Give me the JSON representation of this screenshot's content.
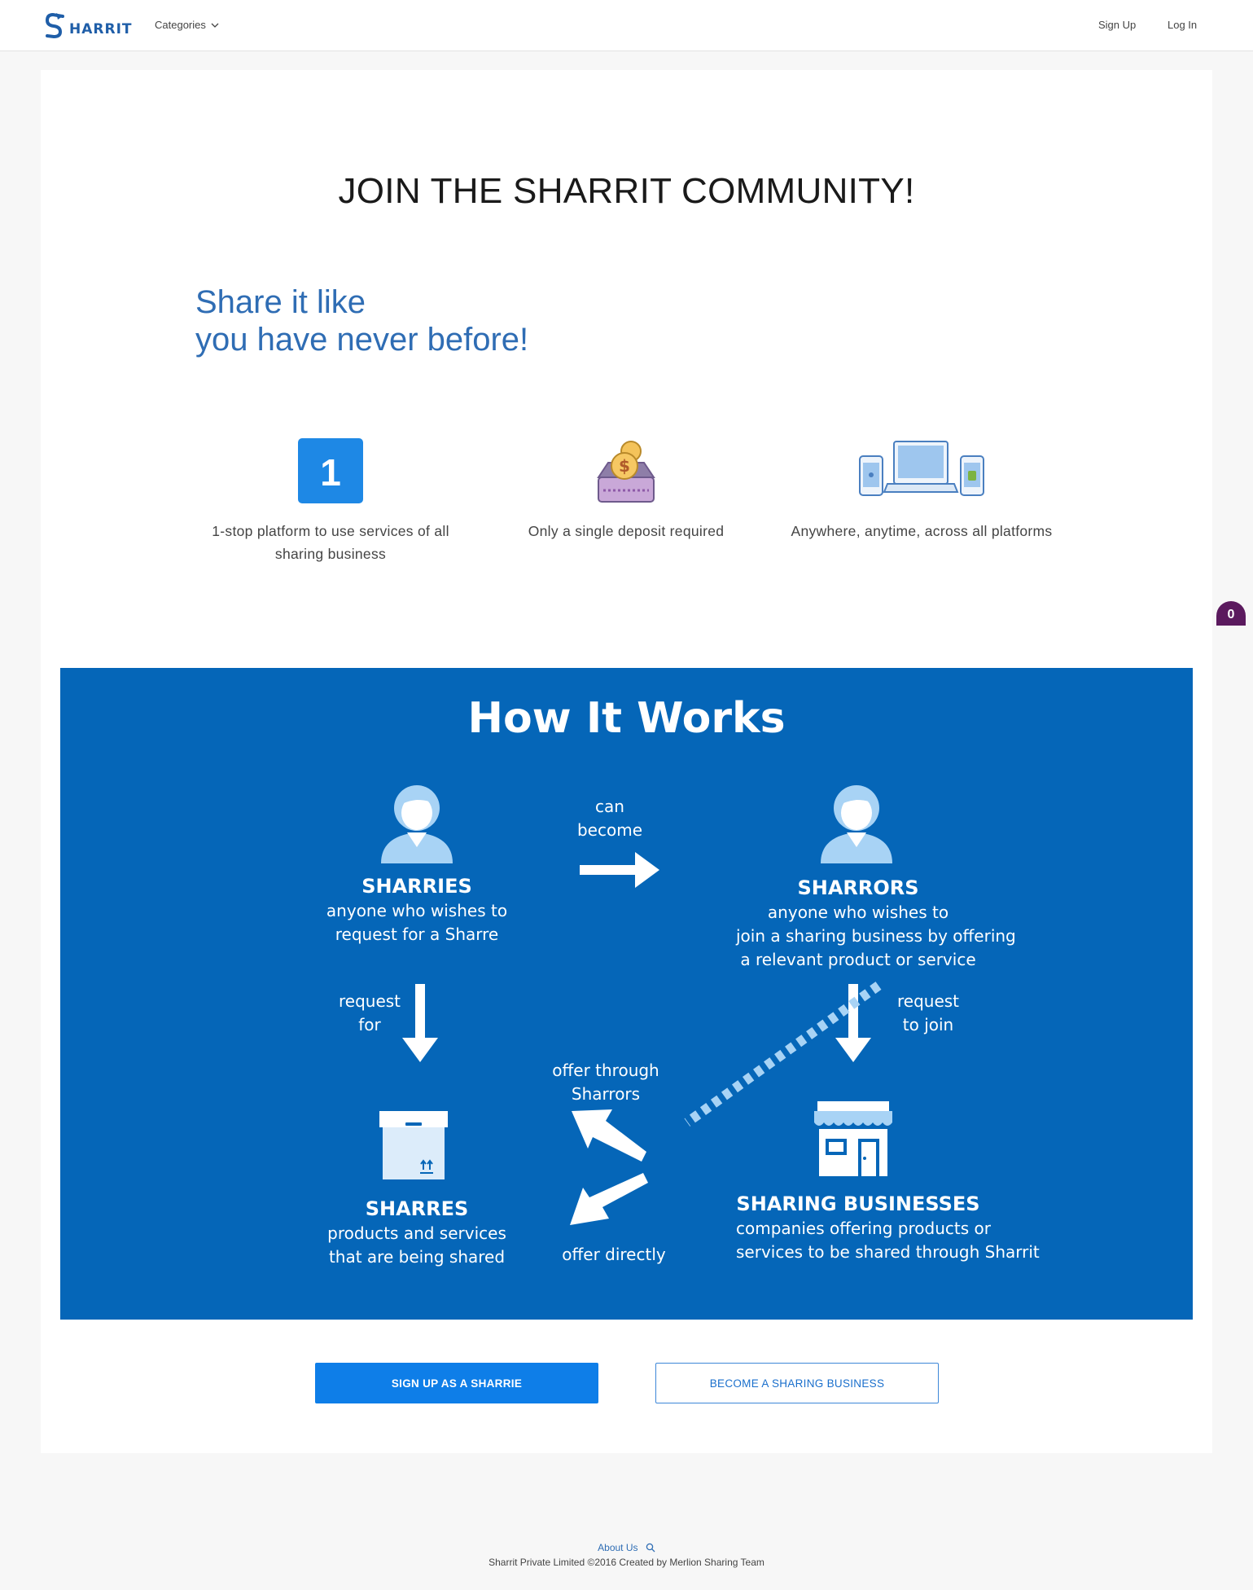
{
  "header": {
    "logo_text": "HARRIT",
    "categories_label": "Categories",
    "signup_label": "Sign Up",
    "login_label": "Log In"
  },
  "main": {
    "title": "JOIN THE SHARRIT COMMUNITY!",
    "tagline_line1": "Share it like",
    "tagline_line2": "you have never before!",
    "features": [
      {
        "icon": "number-one-icon",
        "icon_text": "1",
        "text": "1-stop platform to use services of all sharing business"
      },
      {
        "icon": "deposit-coin-icon",
        "text": "Only a single deposit required"
      },
      {
        "icon": "multi-device-icon",
        "text": "Anywhere, anytime, across all platforms"
      }
    ]
  },
  "how_it_works": {
    "title": "How It Works",
    "sharries": {
      "title": "SHARRIES",
      "desc1": "anyone who wishes to",
      "desc2": "request for a Sharre"
    },
    "sharrors": {
      "title": "SHARRORS",
      "desc1": "anyone who wishes to",
      "desc2": "join a sharing business by offering",
      "desc3": "a relevant product or service"
    },
    "sharres": {
      "title": "SHARRES",
      "desc1": "products and services",
      "desc2": "that are being shared"
    },
    "businesses": {
      "title": "SHARING BUSINESSES",
      "desc1": "companies offering products or",
      "desc2": "services to be shared through Sharrit"
    },
    "can_become": {
      "line1": "can",
      "line2": "become"
    },
    "request_for": {
      "line1": "request",
      "line2": "for"
    },
    "request_to_join": {
      "line1": "request",
      "line2": "to join"
    },
    "offer_through": {
      "line1": "offer through",
      "line2": "Sharrors"
    },
    "offer_directly": "offer directly"
  },
  "actions": {
    "signup_sharrie": "SIGN UP AS A SHARRIE",
    "become_business": "BECOME A SHARING BUSINESS"
  },
  "badge": {
    "count": "0"
  },
  "footer": {
    "about": "About Us",
    "copyright": "Sharrit Private Limited ©2016 Created by Merlion Sharing Team"
  },
  "colors": {
    "brand_blue": "#2f6db4",
    "infographic_bg": "#0566b8",
    "primary_button": "#0e7ee8",
    "badge": "#5b1a5e"
  }
}
